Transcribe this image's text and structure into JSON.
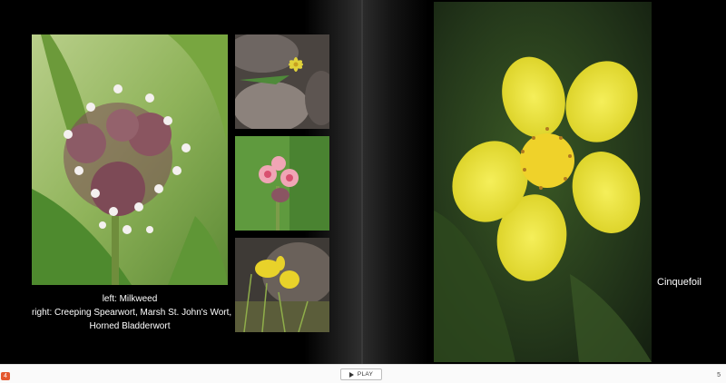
{
  "spread": {
    "left_page": {
      "caption_line1": "left: Milkweed",
      "caption_line2": "right: Creeping Spearwort, Marsh St. John's Wort,",
      "caption_line3": "Horned Bladderwort",
      "photos": [
        {
          "name": "milkweed-photo",
          "subject": "Milkweed"
        },
        {
          "name": "creeping-spearwort-photo",
          "subject": "Creeping Spearwort"
        },
        {
          "name": "marsh-st-johns-wort-photo",
          "subject": "Marsh St. John's Wort"
        },
        {
          "name": "horned-bladderwort-photo",
          "subject": "Horned Bladderwort"
        }
      ]
    },
    "right_page": {
      "caption": "Cinquefoil",
      "photo": {
        "name": "cinquefoil-photo",
        "subject": "Cinquefoil"
      }
    }
  },
  "footer": {
    "left_page_number": "4",
    "play_label": "PLAY",
    "right_page_number": "5",
    "play_icon": "play-icon"
  },
  "colors": {
    "page_background": "#000000",
    "footer_background": "#fafafa",
    "page_badge": "#e4572e",
    "caption_text": "#ffffff"
  }
}
